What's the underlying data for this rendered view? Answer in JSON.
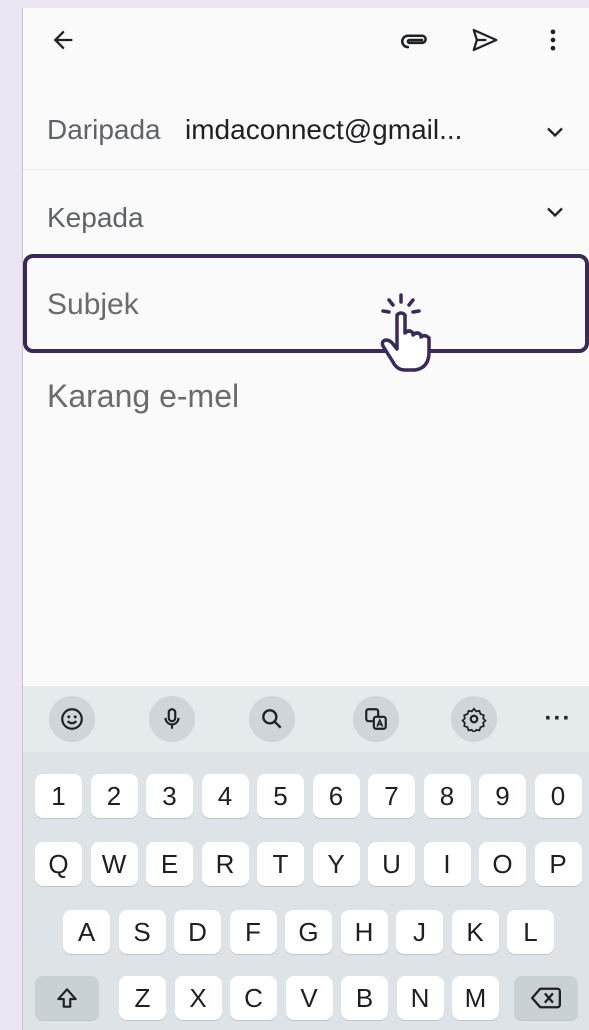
{
  "toolbar": {
    "back_icon": "arrow-left-icon",
    "attach_icon": "paperclip-icon",
    "send_icon": "send-icon",
    "more_icon": "more-vert-icon"
  },
  "compose": {
    "from_label": "Daripada",
    "from_value": "imdaconnect@gmail...",
    "to_label": "Kepada",
    "subject_placeholder": "Subjek",
    "body_placeholder": "Karang e-mel"
  },
  "keyboard": {
    "toolbar_icons": [
      "emoji-icon",
      "mic-icon",
      "search-icon",
      "translate-icon",
      "settings-icon",
      "more-horiz-icon"
    ],
    "more_label": "···",
    "numbers": [
      "1",
      "2",
      "3",
      "4",
      "5",
      "6",
      "7",
      "8",
      "9",
      "0"
    ],
    "row1": [
      "Q",
      "W",
      "E",
      "R",
      "T",
      "Y",
      "U",
      "I",
      "O",
      "P"
    ],
    "row2": [
      "A",
      "S",
      "D",
      "F",
      "G",
      "H",
      "J",
      "K",
      "L"
    ],
    "row3": [
      "Z",
      "X",
      "C",
      "V",
      "B",
      "N",
      "M"
    ]
  },
  "colors": {
    "highlight": "#3a2a57",
    "background": "#ebe5f3"
  }
}
